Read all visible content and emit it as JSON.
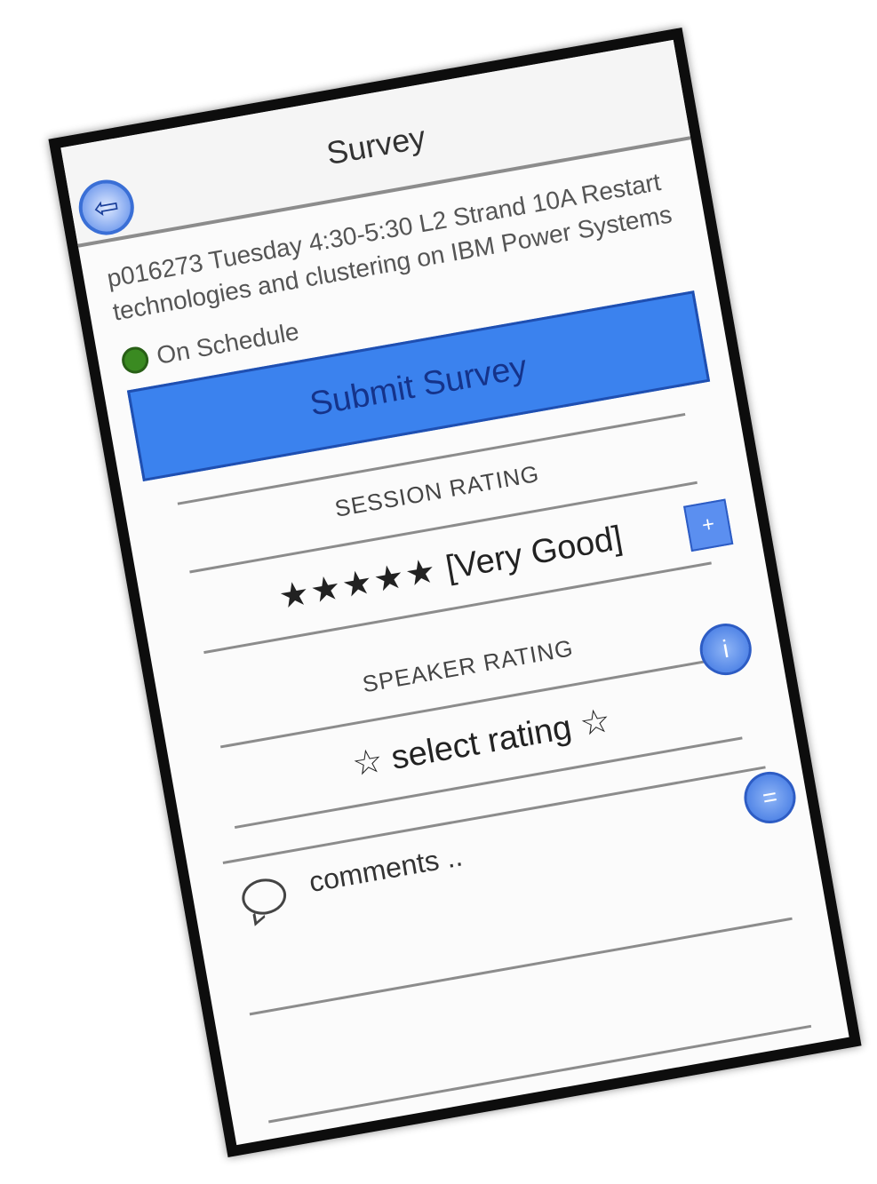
{
  "header": {
    "title": "Survey",
    "back_icon": "arrow-left-circle-icon",
    "back_glyph": "⇦"
  },
  "session": {
    "description": "p016273 Tuesday 4:30-5:30 L2 Strand 10A Restart technologies and clustering on IBM Power Systems",
    "status": "On Schedule",
    "status_color": "#3a8a21"
  },
  "submit": {
    "label": "Submit Survey",
    "color": "#3b82ee"
  },
  "session_rating": {
    "title": "SESSION RATING",
    "stars": "★★★★★",
    "rating": 5,
    "label": "[Very Good]",
    "side_button_glyph": "+"
  },
  "speaker_rating": {
    "title": "SPEAKER RATING",
    "value": "☆ select rating ☆",
    "side_button_glyph": "i"
  },
  "comments": {
    "placeholder": "comments ..",
    "icon": "speech-bubble-icon",
    "side_button_glyph": "="
  }
}
